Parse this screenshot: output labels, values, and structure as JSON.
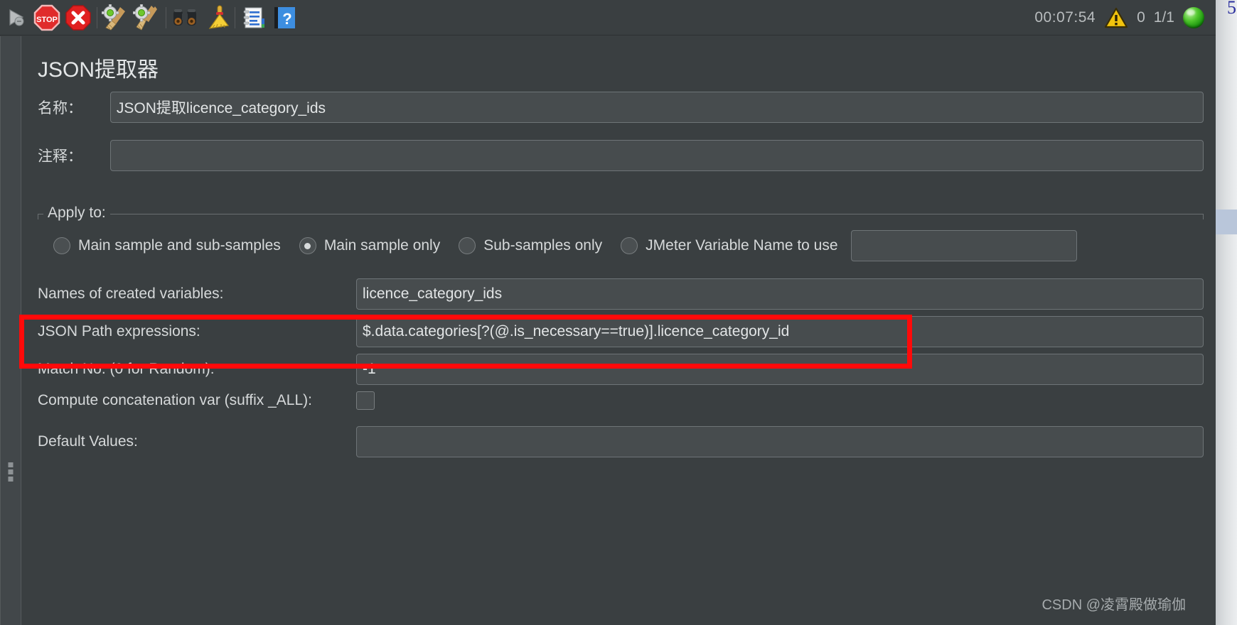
{
  "toolbar": {
    "buttons": [
      {
        "name": "start-button",
        "icon": "play-arrow-icon",
        "label": "Start"
      },
      {
        "name": "stop-button",
        "icon": "stop-sign-icon",
        "label": "Stop"
      },
      {
        "name": "shutdown-button",
        "icon": "red-x-icon",
        "label": "Shutdown"
      },
      {
        "name": "clear-button",
        "icon": "gear-broom-icon",
        "label": "Clear"
      },
      {
        "name": "clear-all-button",
        "icon": "gear-broom-icon",
        "label": "Clear All"
      },
      {
        "name": "search-button",
        "icon": "binoculars-icon",
        "label": "Search"
      },
      {
        "name": "reset-search-button",
        "icon": "yellow-broom-icon",
        "label": "Reset Search"
      },
      {
        "name": "function-helper-button",
        "icon": "notes-list-icon",
        "label": "Function Helper"
      },
      {
        "name": "help-button",
        "icon": "blue-question-icon",
        "label": "Help"
      }
    ],
    "timer": "00:07:54",
    "warning_icon": "warning-triangle-icon",
    "warning_count": "0",
    "thread_count": "1/1",
    "run_indicator": "green-orb-icon"
  },
  "panel": {
    "title": "JSON提取器",
    "name_label": "名称：",
    "name_value": "JSON提取licence_category_ids",
    "comment_label": "注释：",
    "comment_value": "",
    "apply_to": {
      "legend": "Apply to:",
      "options": [
        {
          "label": "Main sample and sub-samples",
          "selected": false
        },
        {
          "label": "Main sample only",
          "selected": true
        },
        {
          "label": "Sub-samples only",
          "selected": false
        },
        {
          "label": "JMeter Variable Name to use",
          "selected": false
        }
      ],
      "variable_name_value": ""
    },
    "fields": [
      {
        "label": "Names of created variables:",
        "value": "licence_category_ids"
      },
      {
        "label": "JSON Path expressions:",
        "value": "$.data.categories[?(@.is_necessary==true)].licence_category_id"
      },
      {
        "label": "Match No. (0 for Random):",
        "value": "-1"
      }
    ],
    "concat_label": "Compute concatenation var (suffix _ALL):",
    "concat_checked": false,
    "default_values_label": "Default Values:",
    "default_values_value": ""
  },
  "annotation": {
    "highlight_color": "#ff0a0a",
    "highlight_target": "Match No. (0 for Random):"
  },
  "background_window": {
    "visible_text": "5"
  },
  "watermark": "CSDN @凌霄殿做瑜伽"
}
